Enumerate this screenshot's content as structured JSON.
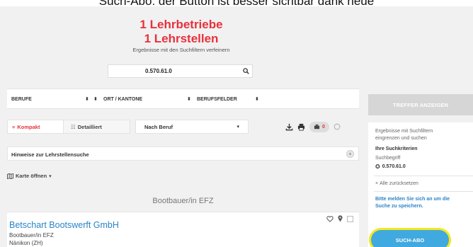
{
  "caption": "Such-Abo: der Button ist besser sichtbar dank neue",
  "results": {
    "line1": "1 Lehrbetriebe",
    "line2": "1 Lehrstellen",
    "hint": "Ergebnisse mit den Suchfiltern verfeinern"
  },
  "search": {
    "value": "0.570.61.0"
  },
  "filters": {
    "berufe": "BERUFE",
    "ort": "ORT / KANTONE",
    "berufsfelder": "BERUFSFELDER"
  },
  "view": {
    "kompakt": "Kompakt",
    "detailliert": "Detailliert",
    "sort": "Nach Beruf",
    "merkliste_count": "0"
  },
  "hinweise": "Hinweise zur Lehrstellensuche",
  "karte": "Karte öffnen",
  "section": "Bootbauer/in EFZ",
  "card": {
    "title": "Betschart Bootswerft GmbH",
    "beruf": "Bootbauer/in EFZ",
    "ort": "Nänikon (ZH)"
  },
  "sidebar": {
    "treffer": "TREFFER ANZEIGEN",
    "intro1": "Ergebnisse mit Suchfiltern",
    "intro2": "eingrenzen und suchen",
    "kriterien": "Ihre Suchkriterien",
    "suchbegriff": "Suchbegriff",
    "suchbegriff_value": "0.570.61.0",
    "reset": "Alle zurücksetzen",
    "login1": "Bitte melden Sie sich an um die",
    "login2": "Suche zu speichern.",
    "suchabo": "SUCH-ABO"
  },
  "colors": {
    "brand_red": "#e8313c",
    "link_blue": "#2a84c8",
    "cta_blue": "#40a9e0",
    "highlight_yellow": "#f4e81e"
  }
}
